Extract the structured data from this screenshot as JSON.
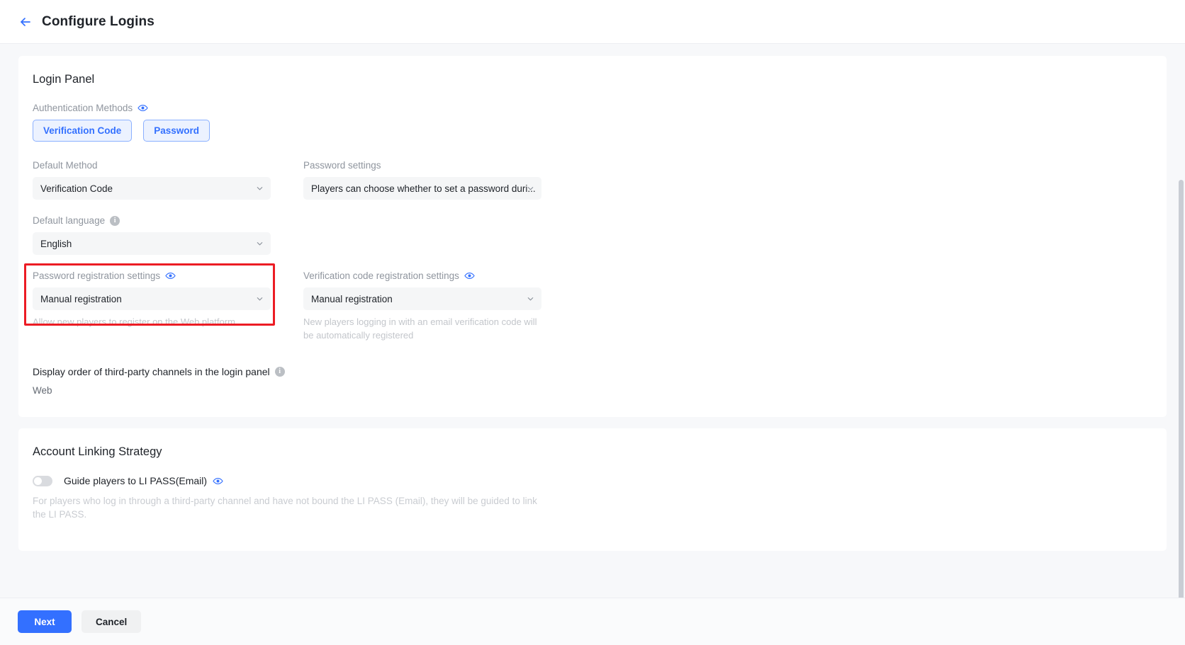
{
  "header": {
    "title": "Configure Logins",
    "back_icon": "arrow-left-icon"
  },
  "login_panel": {
    "title": "Login Panel",
    "auth_methods": {
      "label": "Authentication Methods",
      "eye_icon": "eye-icon",
      "chips": [
        {
          "label": "Verification Code"
        },
        {
          "label": "Password"
        }
      ]
    },
    "default_method": {
      "label": "Default Method",
      "value": "Verification Code"
    },
    "password_settings": {
      "label": "Password settings",
      "value": "Players can choose whether to set a password duri..."
    },
    "default_language": {
      "label": "Default language",
      "info_icon": "info-icon",
      "value": "English"
    },
    "password_registration": {
      "label": "Password registration settings",
      "eye_icon": "eye-icon",
      "value": "Manual registration",
      "help": "Allow new players to register on the Web platform",
      "highlighted": true
    },
    "verification_registration": {
      "label": "Verification code registration settings",
      "eye_icon": "eye-icon",
      "value": "Manual registration",
      "help": "New players logging in with an email verification code will be automatically registered"
    },
    "third_party_order": {
      "label": "Display order of third-party channels in the login panel",
      "info_icon": "info-icon",
      "platform": "Web"
    }
  },
  "account_linking": {
    "title": "Account Linking Strategy",
    "toggle": {
      "label": "Guide players to LI PASS(Email)",
      "eye_icon": "eye-icon",
      "state": "off"
    },
    "description": "For players who log in through a third-party channel and have not bound the LI PASS (Email), they will be guided to link the LI PASS."
  },
  "footer": {
    "next_label": "Next",
    "cancel_label": "Cancel"
  },
  "colors": {
    "accent": "#3370ff",
    "highlight": "#ec1c24",
    "chip_bg": "#ecf2ff",
    "page_bg": "#f7f8fa"
  }
}
